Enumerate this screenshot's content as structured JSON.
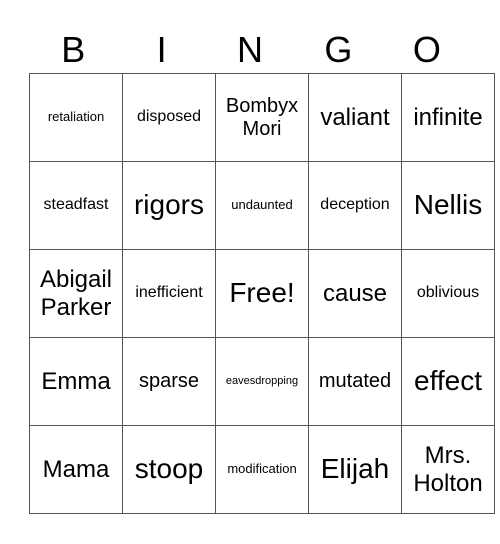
{
  "header": [
    "B",
    "I",
    "N",
    "G",
    "O"
  ],
  "rows": [
    [
      "retaliation",
      "disposed",
      "Bombyx Mori",
      "valiant",
      "infinite"
    ],
    [
      "steadfast",
      "rigors",
      "undaunted",
      "deception",
      "Nellis"
    ],
    [
      "Abigail Parker",
      "inefficient",
      "Free!",
      "cause",
      "oblivious"
    ],
    [
      "Emma",
      "sparse",
      "eavesdropping",
      "mutated",
      "effect"
    ],
    [
      "Mama",
      "stoop",
      "modification",
      "Elijah",
      "Mrs. Holton"
    ]
  ]
}
